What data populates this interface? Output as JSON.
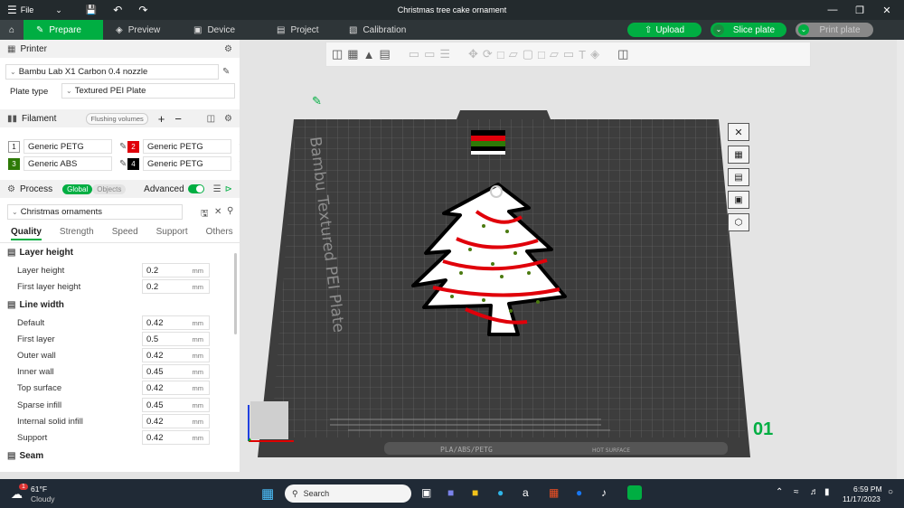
{
  "window": {
    "title": "Christmas tree cake ornament",
    "file_menu": "File"
  },
  "tabs": [
    {
      "label": "Prepare"
    },
    {
      "label": "Preview"
    },
    {
      "label": "Device"
    },
    {
      "label": "Project"
    },
    {
      "label": "Calibration"
    }
  ],
  "actions": {
    "upload": "Upload",
    "slice": "Slice plate",
    "print": "Print plate"
  },
  "printer": {
    "section_label": "Printer",
    "name": "Bambu Lab X1 Carbon 0.4 nozzle",
    "plate_type_label": "Plate type",
    "plate_type_value": "Textured PEI Plate"
  },
  "filament": {
    "section_label": "Filament",
    "flushing_label": "Flushing volumes",
    "items": [
      {
        "num": "1",
        "name": "Generic PETG",
        "color": "#ffffff"
      },
      {
        "num": "2",
        "name": "Generic PETG",
        "color": "#e0000a"
      },
      {
        "num": "3",
        "name": "Generic ABS",
        "color": "#2e7a07"
      },
      {
        "num": "4",
        "name": "Generic PETG",
        "color": "#000000"
      }
    ]
  },
  "process": {
    "section_label": "Process",
    "global_label": "Global",
    "objects_label": "Objects",
    "advanced_label": "Advanced",
    "preset": "Christmas ornaments",
    "tabs": [
      "Quality",
      "Strength",
      "Speed",
      "Support",
      "Others"
    ]
  },
  "quality": {
    "layer_height_head": "Layer height",
    "layer_height_label": "Layer height",
    "layer_height_val": "0.2",
    "first_layer_height_label": "First layer height",
    "first_layer_height_val": "0.2",
    "line_width_head": "Line width",
    "default_label": "Default",
    "default_val": "0.42",
    "first_layer_label": "First layer",
    "first_layer_val": "0.5",
    "outer_wall_label": "Outer wall",
    "outer_wall_val": "0.42",
    "inner_wall_label": "Inner wall",
    "inner_wall_val": "0.45",
    "top_surface_label": "Top surface",
    "top_surface_val": "0.42",
    "sparse_infill_label": "Sparse infill",
    "sparse_infill_val": "0.45",
    "internal_solid_infill_label": "Internal solid infill",
    "internal_solid_infill_val": "0.42",
    "support_label": "Support",
    "support_val": "0.42",
    "unit": "mm",
    "seam_head": "Seam"
  },
  "plate": {
    "name_text": "Bambu Textured PEI Plate",
    "plate_number": "01",
    "bottom_label": "PLA/ABS/PETG",
    "hot_surface": "HOT SURFACE"
  },
  "taskbar": {
    "temperature": "61°F",
    "weather": "Cloudy",
    "weather_badge": "1",
    "search_placeholder": "Search",
    "time": "6:59 PM",
    "date": "11/17/2023"
  },
  "colors": {
    "accent": "#00ae42",
    "dark_bar": "#232a2d"
  }
}
